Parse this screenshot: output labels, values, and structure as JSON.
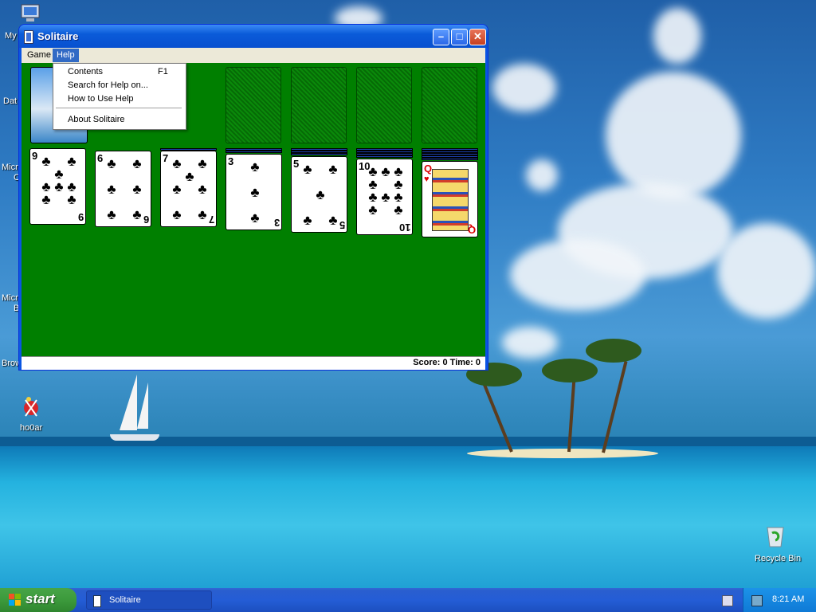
{
  "desktop": {
    "icons": [
      {
        "label": "My",
        "name": "my-computer-icon"
      },
      {
        "label": "Dat",
        "name": "data-icon"
      },
      {
        "label": "Micro",
        "name": "microsoft-icon-1"
      },
      {
        "label": "C",
        "name": "microsoft-icon-1-line2"
      },
      {
        "label": "Micro",
        "name": "microsoft-icon-2"
      },
      {
        "label": "B",
        "name": "microsoft-icon-2-line2"
      },
      {
        "label": "Brow",
        "name": "browser-icon"
      },
      {
        "label": "ho0ar",
        "name": "ho0ar-icon"
      },
      {
        "label": "Recycle Bin",
        "name": "recycle-bin-icon"
      }
    ]
  },
  "window": {
    "title": "Solitaire",
    "menus": [
      "Game",
      "Help"
    ],
    "active_menu": "Help",
    "status": "Score: 0 Time: 0"
  },
  "help_menu": {
    "items": [
      {
        "label": "Contents",
        "shortcut": "F1"
      },
      {
        "label": "Search for Help on...",
        "shortcut": ""
      },
      {
        "label": "How to Use Help",
        "shortcut": ""
      },
      {
        "label": "About Solitaire",
        "shortcut": ""
      }
    ]
  },
  "tableau": [
    {
      "rank": "9",
      "suit": "clubs",
      "face_down_count": 0
    },
    {
      "rank": "6",
      "suit": "clubs",
      "face_down_count": 0
    },
    {
      "rank": "7",
      "suit": "clubs",
      "face_down_count": 0
    },
    {
      "rank": "3",
      "suit": "clubs",
      "face_down_count": 3
    },
    {
      "rank": "5",
      "suit": "clubs",
      "face_down_count": 4
    },
    {
      "rank": "10",
      "suit": "clubs",
      "face_down_count": 5
    },
    {
      "rank": "Q",
      "suit": "hearts",
      "face_down_count": 6
    }
  ],
  "taskbar": {
    "start_label": "start",
    "task_label": "Solitaire",
    "clock": "8:21 AM"
  },
  "colors": {
    "felt": "#007f00",
    "title_bar": "#0a5bd9",
    "start_button": "#3c9a3c",
    "taskbar": "#245dd6"
  }
}
